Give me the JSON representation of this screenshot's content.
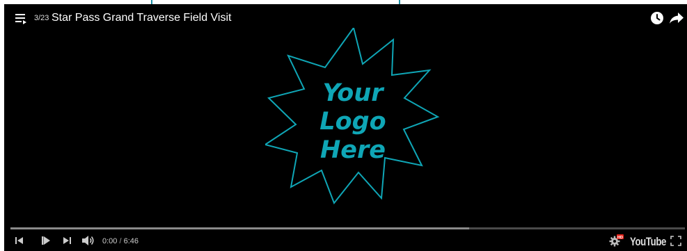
{
  "header": {
    "playlist_icon": "playlist-icon",
    "playlist_position": "3/23",
    "title": "Star Pass Grand Traverse Field Visit",
    "watch_later_icon": "clock-icon",
    "share_icon": "share-arrow-icon"
  },
  "logo": {
    "line1": "Your",
    "line2": "Logo",
    "line3": "Here",
    "color": "#0fa6b6"
  },
  "progress": {
    "played_fraction": 0.0,
    "loaded_fraction": 0.68
  },
  "controls": {
    "previous_icon": "previous-icon",
    "play_icon": "play-icon",
    "next_icon": "next-icon",
    "volume_icon": "volume-icon",
    "current_time": "0:00",
    "separator": " / ",
    "duration": "6:46",
    "settings_icon": "settings-gear-icon",
    "hd_badge": "HD",
    "youtube_label": "YouTube",
    "fullscreen_icon": "fullscreen-icon"
  },
  "colors": {
    "background": "#000000",
    "accent": "#0fa6b6",
    "hd_badge": "#e62117"
  }
}
